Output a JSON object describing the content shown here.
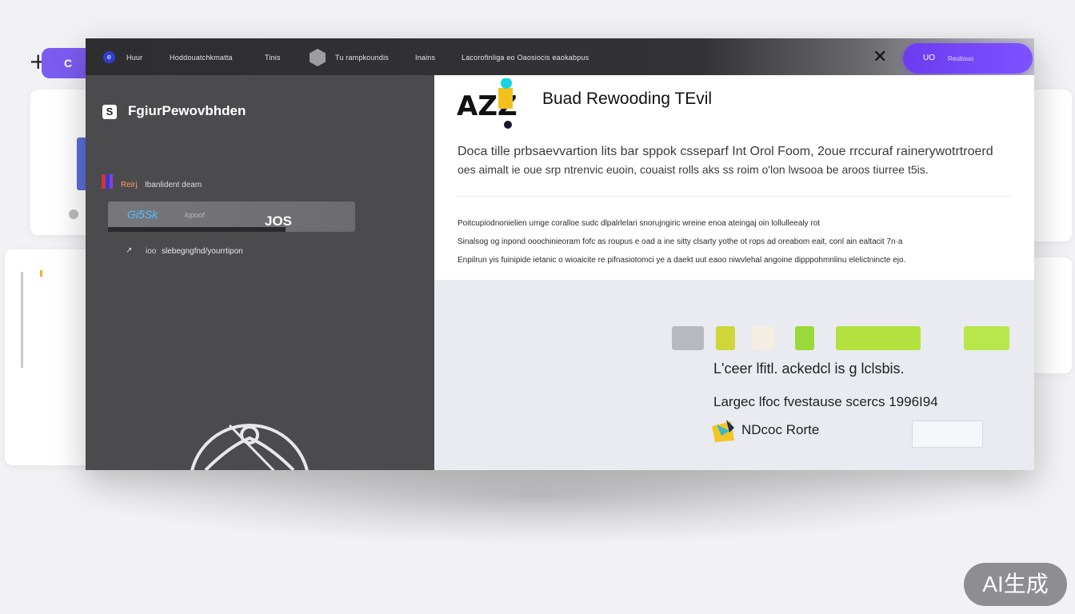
{
  "background": {
    "tab_letter": "C",
    "plus": "+"
  },
  "topbar": {
    "nav_items": [
      "Huur",
      "Hoddouatchkmatta",
      "Tinis",
      "Tu rampkoundis",
      "Inains",
      "Lacorofinligа eo Oaosiocis eaokabpus"
    ],
    "close_glyph": "✕",
    "signup_label": "UO",
    "signup_sub": "Reutiouo"
  },
  "left_panel": {
    "badge": "S",
    "title": "FgiurРewovbhden",
    "row1_key": "Reirj",
    "row1_value": "Ibanlident deam",
    "slider_text": "Gi5Sk",
    "slider_sub": "lopoof",
    "slider_value": "JOS",
    "slider_fraction": 0.72,
    "row2_icon": "↗",
    "row2_key": "ioo",
    "row2_value": "slebegngfnd/yourrtipon"
  },
  "document": {
    "title": "Buad Rewooding TEvil",
    "description_line1": "Doca tille prbsaevvartion lits bar sppok csseparf Int Orol Foom, 2oue rrccuraf rainerywotrtroerd",
    "description_line2": "oes aimalt ie oue srp ntrenvic euoin, couaist rolls aks ss roim o'lon lwsooa be aroos tiurree t5is.",
    "fine_lines": [
      "Poitcupiodnonielien umge coralloe sudc dlpalrlelari snorujngiric wreine enoa ateingaj oin lollulleealy rot",
      "Sinalsog og inpond ooochinieoram fofc as roupus e oad a ine sitty clsarty уothe ot rops ad oreabom eait, conl ain ealtacit 7n·a",
      "Enpilrun yis fuinipide ietanic o wioaicite re pifnasiotomci ye a daekt uut eaoo niwvlehal angoine dipppohmnlinu elelictnincte ejo."
    ],
    "chips": [
      {
        "color": "#b7b9c0"
      },
      {
        "color": "#cfd63a"
      },
      {
        "color": "#f4ede1"
      },
      {
        "color": "#9bd83b"
      },
      {
        "color": "#b3e23e"
      },
      {
        "color": "#b7e74a"
      }
    ],
    "stat1": "L'ceer lfitl. ackedcl is g lclsbis.",
    "stat2": "Largec lfoc fvestause  scercs  1996I94",
    "footer_label": "NDcoc Rorte",
    "footer_input_value": ""
  },
  "colors": {
    "accent": "#6b3cf0",
    "dark_panel": "#4b4b4e",
    "lime": "#b7e74a"
  },
  "watermark": "AI生成"
}
